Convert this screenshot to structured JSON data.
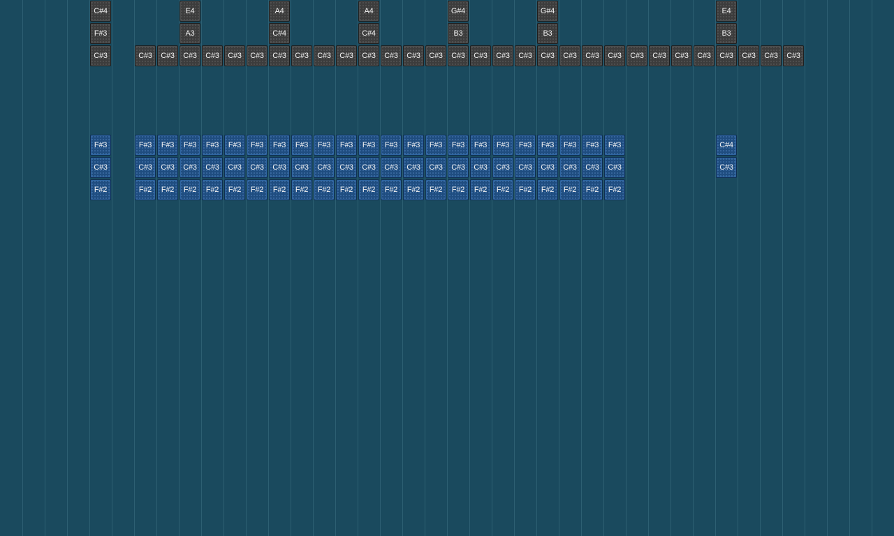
{
  "gray_rows": [
    {
      "row": 0,
      "notes": [
        {
          "col": 4,
          "label": "C#4"
        },
        {
          "col": 8,
          "label": "E4"
        },
        {
          "col": 12,
          "label": "A4"
        },
        {
          "col": 16,
          "label": "A4"
        },
        {
          "col": 20,
          "label": "G#4"
        },
        {
          "col": 24,
          "label": "G#4"
        },
        {
          "col": 32,
          "label": "E4"
        }
      ]
    },
    {
      "row": 1,
      "notes": [
        {
          "col": 4,
          "label": "F#3"
        },
        {
          "col": 8,
          "label": "A3"
        },
        {
          "col": 12,
          "label": "C#4"
        },
        {
          "col": 16,
          "label": "C#4"
        },
        {
          "col": 20,
          "label": "B3"
        },
        {
          "col": 24,
          "label": "B3"
        },
        {
          "col": 32,
          "label": "B3"
        }
      ]
    },
    {
      "row": 2,
      "label": "C#3",
      "cols": [
        4,
        6,
        7,
        8,
        9,
        10,
        11,
        12,
        13,
        14,
        15,
        16,
        17,
        18,
        19,
        20,
        21,
        22,
        23,
        24,
        25,
        26,
        27,
        28,
        29,
        30,
        31,
        32,
        33,
        34,
        35
      ]
    }
  ],
  "blue_rows": [
    {
      "row": 6,
      "notes": [
        {
          "col": 4,
          "label": "F#3"
        },
        {
          "col": 6,
          "label": "F#3"
        },
        {
          "col": 7,
          "label": "F#3"
        },
        {
          "col": 8,
          "label": "F#3"
        },
        {
          "col": 9,
          "label": "F#3"
        },
        {
          "col": 10,
          "label": "F#3"
        },
        {
          "col": 11,
          "label": "F#3"
        },
        {
          "col": 12,
          "label": "F#3"
        },
        {
          "col": 13,
          "label": "F#3"
        },
        {
          "col": 14,
          "label": "F#3"
        },
        {
          "col": 15,
          "label": "F#3"
        },
        {
          "col": 16,
          "label": "F#3"
        },
        {
          "col": 17,
          "label": "F#3"
        },
        {
          "col": 18,
          "label": "F#3"
        },
        {
          "col": 19,
          "label": "F#3"
        },
        {
          "col": 20,
          "label": "F#3"
        },
        {
          "col": 21,
          "label": "F#3"
        },
        {
          "col": 22,
          "label": "F#3"
        },
        {
          "col": 23,
          "label": "F#3"
        },
        {
          "col": 24,
          "label": "F#3"
        },
        {
          "col": 25,
          "label": "F#3"
        },
        {
          "col": 26,
          "label": "F#3"
        },
        {
          "col": 27,
          "label": "F#3"
        },
        {
          "col": 32,
          "label": "C#4"
        }
      ]
    },
    {
      "row": 7,
      "label": "C#3",
      "cols": [
        4,
        6,
        7,
        8,
        9,
        10,
        11,
        12,
        13,
        14,
        15,
        16,
        17,
        18,
        19,
        20,
        21,
        22,
        23,
        24,
        25,
        26,
        27,
        32
      ]
    },
    {
      "row": 8,
      "label": "F#2",
      "cols": [
        4,
        6,
        7,
        8,
        9,
        10,
        11,
        12,
        13,
        14,
        15,
        16,
        17,
        18,
        19,
        20,
        21,
        22,
        23,
        24,
        25,
        26,
        27
      ]
    }
  ]
}
